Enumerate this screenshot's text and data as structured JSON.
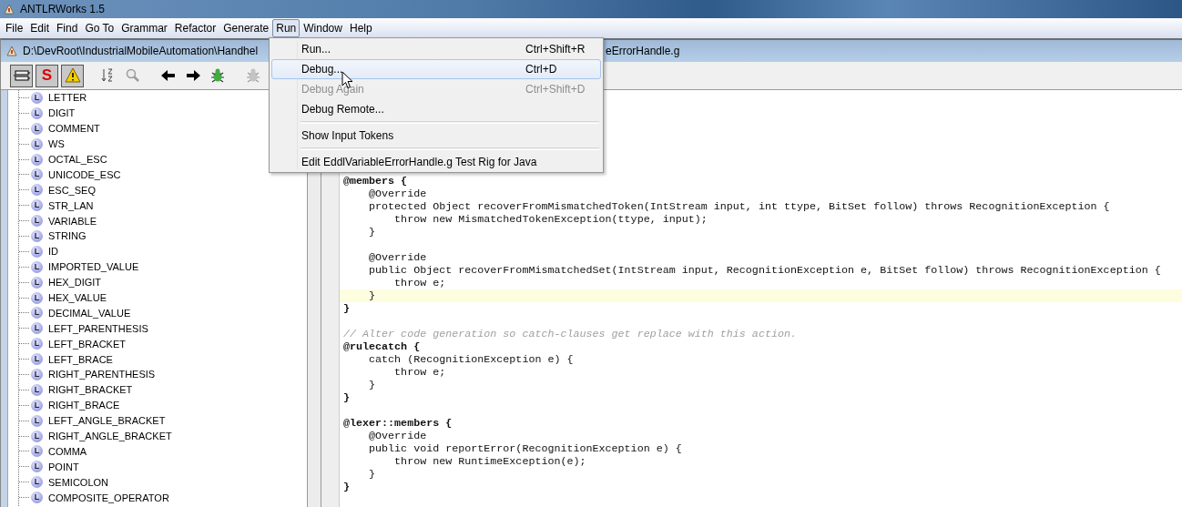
{
  "window": {
    "title": "ANTLRWorks 1.5"
  },
  "menubar": [
    {
      "label": "File",
      "selected": false
    },
    {
      "label": "Edit",
      "selected": false
    },
    {
      "label": "Find",
      "selected": false
    },
    {
      "label": "Go To",
      "selected": false
    },
    {
      "label": "Grammar",
      "selected": false
    },
    {
      "label": "Refactor",
      "selected": false
    },
    {
      "label": "Generate",
      "selected": false
    },
    {
      "label": "Run",
      "selected": true
    },
    {
      "label": "Window",
      "selected": false
    },
    {
      "label": "Help",
      "selected": false
    }
  ],
  "document": {
    "title_start": "D:\\DevRoot\\IndustrialMobileAutomation\\Handhel",
    "title_end": "eErrorHandle.g"
  },
  "toolbar": [
    {
      "kind": "rules",
      "pressed": true,
      "disabled": false
    },
    {
      "kind": "syntax",
      "label": "S",
      "pressed": true,
      "disabled": false
    },
    {
      "kind": "warning",
      "pressed": true,
      "disabled": false
    },
    {
      "kind": "sort",
      "pressed": false,
      "disabled": false
    },
    {
      "kind": "find",
      "pressed": false,
      "disabled": true
    },
    {
      "kind": "back",
      "pressed": false,
      "disabled": false
    },
    {
      "kind": "forward",
      "pressed": false,
      "disabled": false
    },
    {
      "kind": "debug",
      "pressed": false,
      "disabled": false
    },
    {
      "kind": "debug",
      "pressed": false,
      "disabled": true
    }
  ],
  "rules": [
    {
      "label": "LETTER",
      "badge": "L"
    },
    {
      "label": "DIGIT",
      "badge": "L"
    },
    {
      "label": "COMMENT",
      "badge": "L"
    },
    {
      "label": "WS",
      "badge": "L"
    },
    {
      "label": "OCTAL_ESC",
      "badge": "L"
    },
    {
      "label": "UNICODE_ESC",
      "badge": "L"
    },
    {
      "label": "ESC_SEQ",
      "badge": "L"
    },
    {
      "label": "STR_LAN",
      "badge": "L"
    },
    {
      "label": "VARIABLE",
      "badge": "L"
    },
    {
      "label": "STRING",
      "badge": "L"
    },
    {
      "label": "ID",
      "badge": "L"
    },
    {
      "label": "IMPORTED_VALUE",
      "badge": "L"
    },
    {
      "label": "HEX_DIGIT",
      "badge": "L"
    },
    {
      "label": "HEX_VALUE",
      "badge": "L"
    },
    {
      "label": "DECIMAL_VALUE",
      "badge": "L"
    },
    {
      "label": "LEFT_PARENTHESIS",
      "badge": "L"
    },
    {
      "label": "LEFT_BRACKET",
      "badge": "L"
    },
    {
      "label": "LEFT_BRACE",
      "badge": "L"
    },
    {
      "label": "RIGHT_PARENTHESIS",
      "badge": "L"
    },
    {
      "label": "RIGHT_BRACKET",
      "badge": "L"
    },
    {
      "label": "RIGHT_BRACE",
      "badge": "L"
    },
    {
      "label": "LEFT_ANGLE_BRACKET",
      "badge": "L"
    },
    {
      "label": "RIGHT_ANGLE_BRACKET",
      "badge": "L"
    },
    {
      "label": "COMMA",
      "badge": "L"
    },
    {
      "label": "POINT",
      "badge": "L"
    },
    {
      "label": "SEMICOLON",
      "badge": "L"
    },
    {
      "label": "COMPOSITE_OPERATOR",
      "badge": "L"
    }
  ],
  "code": [
    {
      "kind": "bold",
      "text": "@members {",
      "current": false
    },
    {
      "kind": "plain",
      "text": "    @Override",
      "current": false
    },
    {
      "kind": "plain",
      "text": "    protected Object recoverFromMismatchedToken(IntStream input, int ttype, BitSet follow) throws RecognitionException {",
      "current": false
    },
    {
      "kind": "plain",
      "text": "        throw new MismatchedTokenException(ttype, input);",
      "current": false
    },
    {
      "kind": "plain",
      "text": "    }",
      "current": false
    },
    {
      "kind": "blank",
      "current": false
    },
    {
      "kind": "plain",
      "text": "    @Override",
      "current": false
    },
    {
      "kind": "plain",
      "text": "    public Object recoverFromMismatchedSet(IntStream input, RecognitionException e, BitSet follow) throws RecognitionException {",
      "current": false
    },
    {
      "kind": "plain",
      "text": "        throw e;",
      "current": false
    },
    {
      "kind": "plain",
      "text": "    }",
      "current": true
    },
    {
      "kind": "bold",
      "text": "}",
      "current": false
    },
    {
      "kind": "blank",
      "current": false
    },
    {
      "kind": "comment",
      "text": "// Alter code generation so catch-clauses get replace with this action.",
      "current": false
    },
    {
      "kind": "bold",
      "text": "@rulecatch {",
      "current": false
    },
    {
      "kind": "plain",
      "text": "    catch (RecognitionException e) {",
      "current": false
    },
    {
      "kind": "plain",
      "text": "        throw e;",
      "current": false
    },
    {
      "kind": "plain",
      "text": "    }",
      "current": false
    },
    {
      "kind": "bold",
      "text": "}",
      "current": false
    },
    {
      "kind": "blank",
      "current": false
    },
    {
      "kind": "bold",
      "text": "@lexer::members {",
      "current": false
    },
    {
      "kind": "plain",
      "text": "    @Override",
      "current": false
    },
    {
      "kind": "plain",
      "text": "    public void reportError(RecognitionException e) {",
      "current": false
    },
    {
      "kind": "plain",
      "text": "        throw new RuntimeException(e);",
      "current": false
    },
    {
      "kind": "plain",
      "text": "    }",
      "current": false
    },
    {
      "kind": "bold",
      "text": "}",
      "current": false
    }
  ],
  "run_menu": [
    {
      "kind": "item",
      "label": "Run...",
      "shortcut": "Ctrl+Shift+R",
      "selected": false,
      "disabled": false
    },
    {
      "kind": "item",
      "label": "Debug...",
      "shortcut": "Ctrl+D",
      "selected": true,
      "disabled": false
    },
    {
      "kind": "item",
      "label": "Debug Again",
      "shortcut": "Ctrl+Shift+D",
      "selected": false,
      "disabled": true
    },
    {
      "kind": "item",
      "label": "Debug Remote...",
      "selected": false,
      "disabled": false
    },
    {
      "kind": "separator"
    },
    {
      "kind": "item",
      "label": "Show Input Tokens",
      "selected": false,
      "disabled": false
    },
    {
      "kind": "separator"
    },
    {
      "kind": "item",
      "label": "Edit EddlVariableErrorHandle.g Test Rig for Java",
      "selected": false,
      "disabled": false
    }
  ]
}
